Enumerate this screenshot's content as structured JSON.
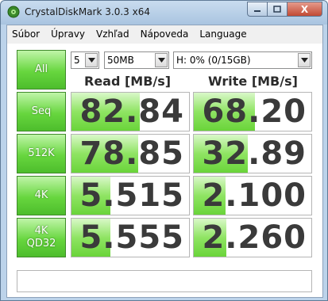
{
  "window": {
    "title": "CrystalDiskMark 3.0.3 x64",
    "close_glyph": "X"
  },
  "menu": [
    "Súbor",
    "Úpravy",
    "Vzhľad",
    "Nápoveda",
    "Language"
  ],
  "controls": {
    "all_button": "All",
    "count": "5",
    "size": "50MB",
    "drive": "H: 0% (0/15GB)"
  },
  "headers": {
    "read": "Read [MB/s]",
    "write": "Write [MB/s]"
  },
  "rows": [
    {
      "label_line1": "Seq",
      "label_line2": "",
      "read": "82.84",
      "write": "68.20",
      "read_fill": 0.58,
      "write_fill": 0.52
    },
    {
      "label_line1": "512K",
      "label_line2": "",
      "read": "78.85",
      "write": "32.89",
      "read_fill": 0.57,
      "write_fill": 0.46
    },
    {
      "label_line1": "4K",
      "label_line2": "",
      "read": "5.515",
      "write": "2.100",
      "read_fill": 0.33,
      "write_fill": 0.27
    },
    {
      "label_line1": "4K",
      "label_line2": "QD32",
      "read": "5.555",
      "write": "2.260",
      "read_fill": 0.33,
      "write_fill": 0.28
    }
  ],
  "comment": "",
  "colors": {
    "accent_green": "#67d63e",
    "value_text": "#3a3a3a"
  }
}
